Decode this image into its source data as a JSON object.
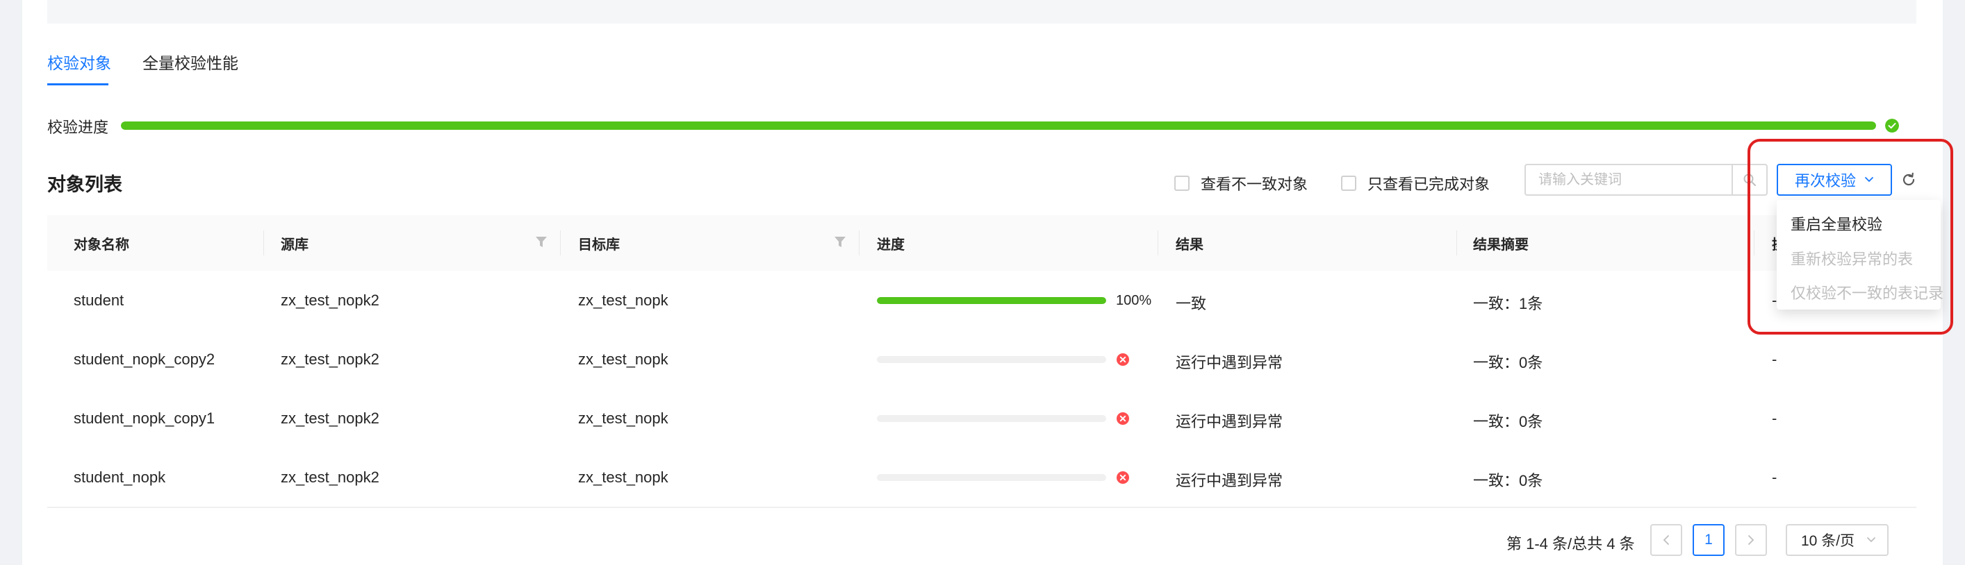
{
  "tabs": [
    {
      "label": "校验对象",
      "active": true
    },
    {
      "label": "全量校验性能",
      "active": false
    }
  ],
  "check_progress": {
    "label": "校验进度",
    "value_percent": 100
  },
  "object_list": {
    "title": "对象列表",
    "filter_inconsistent": "查看不一致对象",
    "filter_completed": "只查看已完成对象",
    "search_placeholder": "请输入关键词",
    "recheck_label": "再次校验",
    "recheck_menu": [
      {
        "label": "重启全量校验",
        "enabled": true
      },
      {
        "label": "重新校验异常的表",
        "enabled": false
      },
      {
        "label": "仅校验不一致的表记录",
        "enabled": false
      }
    ]
  },
  "table": {
    "columns": [
      "对象名称",
      "源库",
      "目标库",
      "进度",
      "结果",
      "结果摘要",
      "操"
    ],
    "rows": [
      {
        "name": "student",
        "source": "zx_test_nopk2",
        "target": "zx_test_nopk",
        "progress": 100,
        "progress_text": "100%",
        "status": "success",
        "result": "一致",
        "summary": "一致：1条",
        "action": "-"
      },
      {
        "name": "student_nopk_copy2",
        "source": "zx_test_nopk2",
        "target": "zx_test_nopk",
        "progress": 0,
        "progress_text": "",
        "status": "error",
        "result": "运行中遇到异常",
        "summary": "一致：0条",
        "action": "-"
      },
      {
        "name": "student_nopk_copy1",
        "source": "zx_test_nopk2",
        "target": "zx_test_nopk",
        "progress": 0,
        "progress_text": "",
        "status": "error",
        "result": "运行中遇到异常",
        "summary": "一致：0条",
        "action": "-"
      },
      {
        "name": "student_nopk",
        "source": "zx_test_nopk2",
        "target": "zx_test_nopk",
        "progress": 0,
        "progress_text": "",
        "status": "error",
        "result": "运行中遇到异常",
        "summary": "一致：0条",
        "action": "-"
      }
    ]
  },
  "pagination": {
    "total_text": "第 1-4 条/总共 4 条",
    "current_page": "1",
    "page_size": "10 条/页"
  },
  "colors": {
    "primary": "#1677ff",
    "success": "#52c41a",
    "error": "#ff4d4f",
    "highlight": "#e02020"
  },
  "icons": [
    "check-circle-icon",
    "search-icon",
    "chevron-down-icon",
    "refresh-icon",
    "filter-icon",
    "close-circle-icon",
    "chevron-left-icon",
    "chevron-right-icon"
  ]
}
